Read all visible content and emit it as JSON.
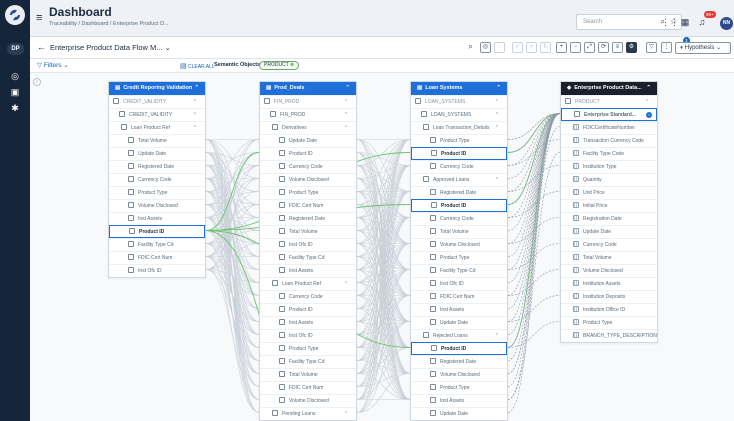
{
  "header": {
    "title": "Dashboard",
    "breadcrumb": "Traceability  /  Dashboard  /  Enterprise Product D...",
    "search_placeholder": "Search",
    "notif_count": "99+",
    "user_initials": "NN"
  },
  "rail": {
    "chip": "DP"
  },
  "flow": {
    "title": "Enterprise Product Data Flow M...",
    "layer_badge": "3",
    "hypothesis": "Hypothesis"
  },
  "filters": {
    "label": "Filters",
    "clear_all": "CLEAR ALL",
    "semantic_label": "Semantic Objects :",
    "chip": "PRODUCT"
  },
  "panels": [
    {
      "id": "credit",
      "header": "Credit Reporing Validation",
      "dark": false,
      "rows": [
        {
          "t": "CREDIT_VALIDITY",
          "lvl": 0,
          "c": true
        },
        {
          "t": "CREDIT_VALIDITY",
          "lvl": 1,
          "c": true
        },
        {
          "t": "Loan Product Ref",
          "lvl": 2,
          "c": true
        },
        {
          "t": "Total Volume",
          "lvl": 3
        },
        {
          "t": "Update Date",
          "lvl": 3
        },
        {
          "t": "Registered Date",
          "lvl": 3
        },
        {
          "t": "Currency Code",
          "lvl": 3
        },
        {
          "t": "Product Type",
          "lvl": 3
        },
        {
          "t": "Volume Disclosed",
          "lvl": 3
        },
        {
          "t": "Inst Assets",
          "lvl": 3
        },
        {
          "t": "Product ID",
          "lvl": 3,
          "sel": true
        },
        {
          "t": "Facility Type Cd",
          "lvl": 3
        },
        {
          "t": "FDIC Cert Num",
          "lvl": 3
        },
        {
          "t": "Inst Ofc ID",
          "lvl": 3
        }
      ]
    },
    {
      "id": "prod",
      "header": "Prod_Deals",
      "dark": false,
      "rows": [
        {
          "t": "FIN_PROD",
          "lvl": 0,
          "c": true
        },
        {
          "t": "FIN_PROD",
          "lvl": 1,
          "c": true
        },
        {
          "t": "Derivatives",
          "lvl": 2,
          "c": true
        },
        {
          "t": "Update Date",
          "lvl": 3
        },
        {
          "t": "Product ID",
          "lvl": 3
        },
        {
          "t": "Currency Code",
          "lvl": 3
        },
        {
          "t": "Volume Disclosed",
          "lvl": 3
        },
        {
          "t": "Product Type",
          "lvl": 3
        },
        {
          "t": "FDIC Cert Num",
          "lvl": 3
        },
        {
          "t": "Registered Date",
          "lvl": 3
        },
        {
          "t": "Total Volume",
          "lvl": 3
        },
        {
          "t": "Inst Ofc ID",
          "lvl": 3
        },
        {
          "t": "Facility Type Cd",
          "lvl": 3
        },
        {
          "t": "Inst Assets",
          "lvl": 3
        },
        {
          "t": "Loan Product Ref",
          "lvl": 2,
          "c": true
        },
        {
          "t": "Currency Code",
          "lvl": 3
        },
        {
          "t": "Product ID",
          "lvl": 3
        },
        {
          "t": "Inst Assets",
          "lvl": 3
        },
        {
          "t": "Inst Ofc ID",
          "lvl": 3
        },
        {
          "t": "Product Type",
          "lvl": 3
        },
        {
          "t": "Facility Type Cd",
          "lvl": 3
        },
        {
          "t": "Total Volume",
          "lvl": 3
        },
        {
          "t": "FDIC Cert Num",
          "lvl": 3
        },
        {
          "t": "Volume Disclosed",
          "lvl": 3
        },
        {
          "t": "Pending Loans",
          "lvl": 2,
          "c": true
        }
      ]
    },
    {
      "id": "loan",
      "header": "Loan Systems",
      "dark": false,
      "rows": [
        {
          "t": "LOAN_SYSTEMS",
          "lvl": 0,
          "c": true
        },
        {
          "t": "LOAN_SYSTEMS",
          "lvl": 1,
          "c": true
        },
        {
          "t": "Loan Transaction_Details",
          "lvl": 2,
          "c": true
        },
        {
          "t": "Product Type",
          "lvl": 3
        },
        {
          "t": "Product ID",
          "lvl": 3,
          "sel": true
        },
        {
          "t": "Currency Code",
          "lvl": 3
        },
        {
          "t": "Approved Loans",
          "lvl": 2,
          "c": true
        },
        {
          "t": "Registered Date",
          "lvl": 3
        },
        {
          "t": "Product ID",
          "lvl": 3,
          "sel": true
        },
        {
          "t": "Currency Code",
          "lvl": 3
        },
        {
          "t": "Total Volume",
          "lvl": 3
        },
        {
          "t": "Volume Disclosed",
          "lvl": 3
        },
        {
          "t": "Product Type",
          "lvl": 3
        },
        {
          "t": "Facility Type Cd",
          "lvl": 3
        },
        {
          "t": "Inst Ofc ID",
          "lvl": 3
        },
        {
          "t": "FDIC Cert Num",
          "lvl": 3
        },
        {
          "t": "Inst Assets",
          "lvl": 3
        },
        {
          "t": "Update Date",
          "lvl": 3
        },
        {
          "t": "Rejected Loans",
          "lvl": 2,
          "c": true
        },
        {
          "t": "Product ID",
          "lvl": 3,
          "sel": true
        },
        {
          "t": "Registered Date",
          "lvl": 3
        },
        {
          "t": "Volume Disclosed",
          "lvl": 3
        },
        {
          "t": "Product Type",
          "lvl": 3
        },
        {
          "t": "Inst Assets",
          "lvl": 3
        },
        {
          "t": "Update Date",
          "lvl": 3
        }
      ]
    },
    {
      "id": "enterprise",
      "header": "Enterprise Product Data...",
      "dark": true,
      "rows": [
        {
          "t": "PRODUCT",
          "lvl": 0,
          "c": true
        },
        {
          "t": "Enterprise Standard...",
          "lvl": 2,
          "sel": true,
          "badge": true
        },
        {
          "t": "FDICCertificateNumber",
          "lvl": 2,
          "g": true
        },
        {
          "t": "Transaction Currency Code",
          "lvl": 2,
          "g": true
        },
        {
          "t": "Facility Type Code",
          "lvl": 2,
          "g": true
        },
        {
          "t": "Institution Type",
          "lvl": 2,
          "g": true
        },
        {
          "t": "Quantity",
          "lvl": 2,
          "g": true
        },
        {
          "t": "Unit Price",
          "lvl": 2,
          "g": true
        },
        {
          "t": "Initial Price",
          "lvl": 2,
          "g": true
        },
        {
          "t": "Registration Date",
          "lvl": 2,
          "g": true
        },
        {
          "t": "Update Date",
          "lvl": 2,
          "g": true
        },
        {
          "t": "Currency Code",
          "lvl": 2,
          "g": true
        },
        {
          "t": "Total Volume",
          "lvl": 2,
          "g": true
        },
        {
          "t": "Volume Disclosed",
          "lvl": 2,
          "g": true
        },
        {
          "t": "Institution Assets",
          "lvl": 2,
          "g": true
        },
        {
          "t": "Institution Deposits",
          "lvl": 2,
          "g": true
        },
        {
          "t": "Institution Office ID",
          "lvl": 2,
          "g": true
        },
        {
          "t": "Product Type",
          "lvl": 2,
          "g": true
        },
        {
          "t": "BRANCH_TYPE_DESCRIPTION",
          "lvl": 2,
          "g": true
        }
      ]
    }
  ],
  "colors": {
    "accent": "#1e6fd9",
    "lineage": "#6cc36c",
    "rail": "#16263a"
  }
}
